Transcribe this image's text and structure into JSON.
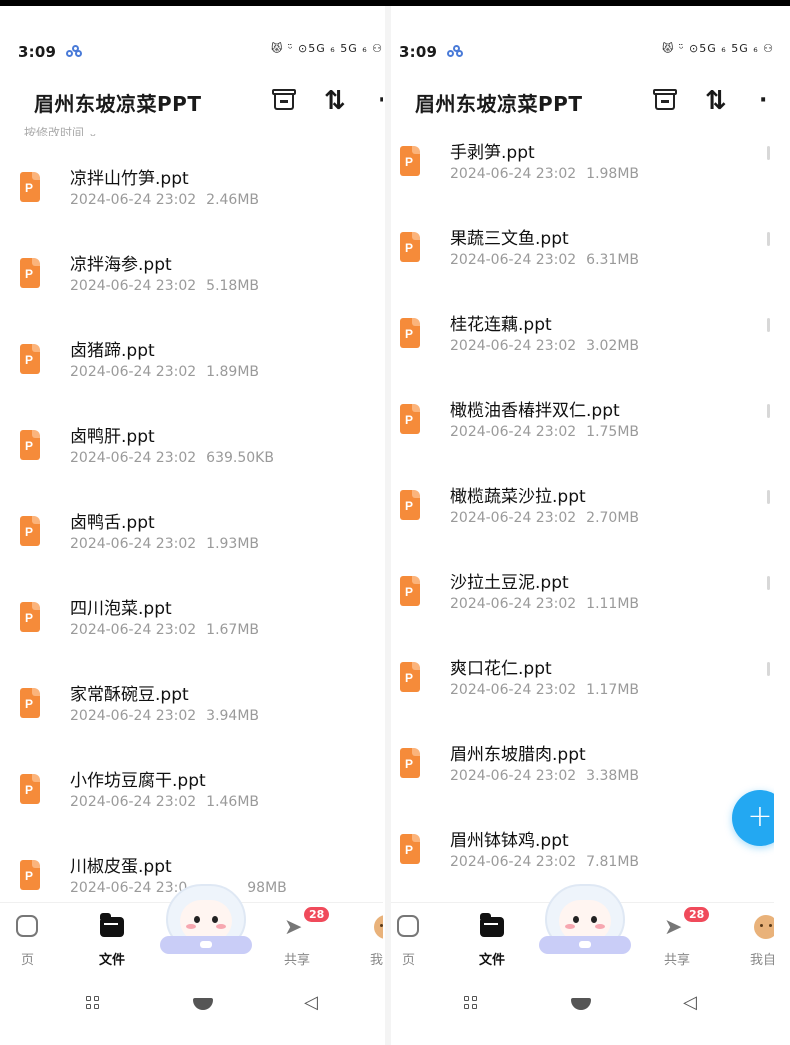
{
  "colors": {
    "accent": "#23a8f2",
    "file_icon": "#f58b3a",
    "badge": "#f04a5b",
    "meta_text": "#9a9a9a"
  },
  "left": {
    "status": {
      "time": "3:09",
      "icons": "😾 ᵕ̈ ⊙5G ₆ 5G ₆ ⚇"
    },
    "appbar": {
      "title": "眉州东坡凉菜PPT",
      "sort_icon": "⇅",
      "more_icon": "·"
    },
    "sort_label": "按修改时间 ⌄",
    "files": [
      {
        "name": "凉拌山竹笋.ppt",
        "date": "2024-06-24 23:02",
        "size": "2.46MB"
      },
      {
        "name": "凉拌海参.ppt",
        "date": "2024-06-24 23:02",
        "size": "5.18MB"
      },
      {
        "name": "卤猪蹄.ppt",
        "date": "2024-06-24 23:02",
        "size": "1.89MB"
      },
      {
        "name": "卤鸭肝.ppt",
        "date": "2024-06-24 23:02",
        "size": "639.50KB"
      },
      {
        "name": "卤鸭舌.ppt",
        "date": "2024-06-24 23:02",
        "size": "1.93MB"
      },
      {
        "name": "四川泡菜.ppt",
        "date": "2024-06-24 23:02",
        "size": "1.67MB"
      },
      {
        "name": "家常酥碗豆.ppt",
        "date": "2024-06-24 23:02",
        "size": "3.94MB"
      },
      {
        "name": "小作坊豆腐干.ppt",
        "date": "2024-06-24 23:02",
        "size": "1.46MB"
      },
      {
        "name": "川椒皮蛋.ppt",
        "date": "2024-06-24 23:0",
        "size": "98MB"
      }
    ],
    "tabs": {
      "home": "页",
      "files": "文件",
      "share": "共享",
      "share_badge": "28",
      "mine": "我的"
    }
  },
  "right": {
    "status": {
      "time": "3:09",
      "icons": "😾 ᵕ̈ ⊙5G ₆ 5G ₆ ⚇"
    },
    "appbar": {
      "title": "眉州东坡凉菜PPT",
      "sort_icon": "⇅",
      "more_icon": "·"
    },
    "files": [
      {
        "name": "手剥笋.ppt",
        "date": "2024-06-24 23:02",
        "size": "1.98MB"
      },
      {
        "name": "果蔬三文鱼.ppt",
        "date": "2024-06-24 23:02",
        "size": "6.31MB"
      },
      {
        "name": "桂花连藕.ppt",
        "date": "2024-06-24 23:02",
        "size": "3.02MB"
      },
      {
        "name": "橄榄油香椿拌双仁.ppt",
        "date": "2024-06-24 23:02",
        "size": "1.75MB"
      },
      {
        "name": "橄榄蔬菜沙拉.ppt",
        "date": "2024-06-24 23:02",
        "size": "2.70MB"
      },
      {
        "name": "沙拉土豆泥.ppt",
        "date": "2024-06-24 23:02",
        "size": "1.11MB"
      },
      {
        "name": "爽口花仁.ppt",
        "date": "2024-06-24 23:02",
        "size": "1.17MB"
      },
      {
        "name": "眉州东坡腊肉.ppt",
        "date": "2024-06-24 23:02",
        "size": "3.38MB"
      },
      {
        "name": "眉州钵钵鸡.ppt",
        "date": "2024-06-24 23:02",
        "size": "7.81MB"
      }
    ],
    "fab": "+",
    "tabs": {
      "home": "页",
      "files": "文件",
      "share": "共享",
      "share_badge": "28",
      "mine": "我自"
    }
  },
  "icons": [
    "cloud-icon",
    "archive-box-icon",
    "sort-icon",
    "more-icon",
    "ppt-file-icon",
    "home-icon",
    "folder-icon",
    "share-plane-icon",
    "avatar-icon",
    "mascot-icon",
    "nav-recents-icon",
    "nav-home-icon",
    "nav-back-icon",
    "add-icon"
  ]
}
